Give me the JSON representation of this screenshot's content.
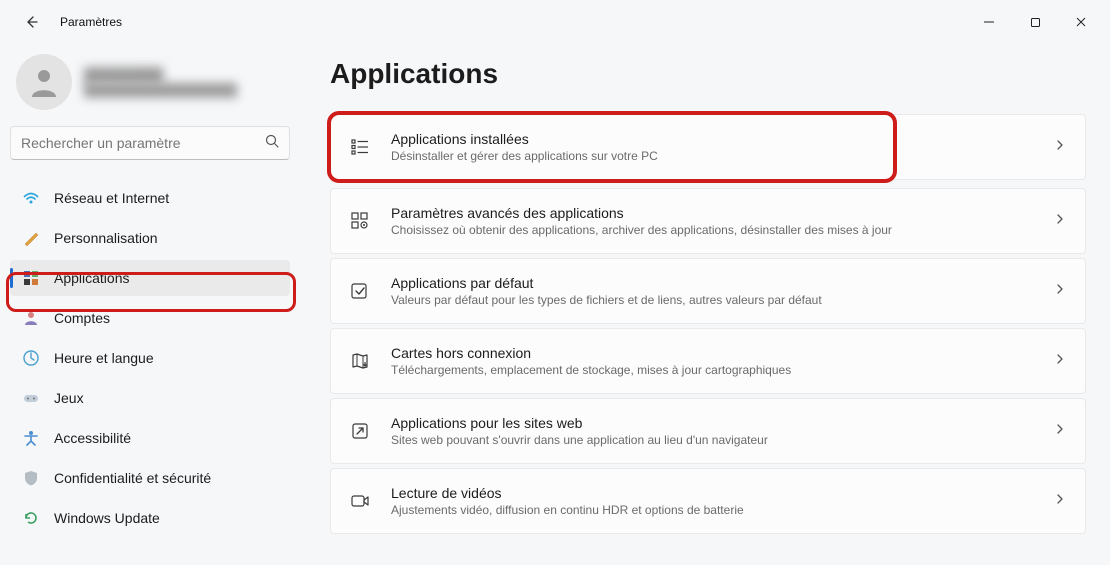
{
  "window": {
    "title": "Paramètres"
  },
  "profile": {
    "name": "████████",
    "email": "██████████████████"
  },
  "search": {
    "placeholder": "Rechercher un paramètre"
  },
  "sidebar": {
    "items": [
      {
        "label": "Réseau et Internet"
      },
      {
        "label": "Personnalisation"
      },
      {
        "label": "Applications"
      },
      {
        "label": "Comptes"
      },
      {
        "label": "Heure et langue"
      },
      {
        "label": "Jeux"
      },
      {
        "label": "Accessibilité"
      },
      {
        "label": "Confidentialité et sécurité"
      },
      {
        "label": "Windows Update"
      }
    ],
    "activeIndex": 2
  },
  "main": {
    "heading": "Applications",
    "cards": [
      {
        "title": "Applications installées",
        "subtitle": "Désinstaller et gérer des applications sur votre PC"
      },
      {
        "title": "Paramètres avancés des applications",
        "subtitle": "Choisissez où obtenir des applications, archiver des applications, désinstaller des mises à jour"
      },
      {
        "title": "Applications par défaut",
        "subtitle": "Valeurs par défaut pour les types de fichiers et de liens, autres valeurs par défaut"
      },
      {
        "title": "Cartes hors connexion",
        "subtitle": "Téléchargements, emplacement de stockage, mises à jour cartographiques"
      },
      {
        "title": "Applications pour les sites web",
        "subtitle": "Sites web pouvant s'ouvrir dans une application au lieu d'un navigateur"
      },
      {
        "title": "Lecture de vidéos",
        "subtitle": "Ajustements vidéo, diffusion en continu HDR et options de batterie"
      }
    ],
    "highlightedIndex": 0
  }
}
